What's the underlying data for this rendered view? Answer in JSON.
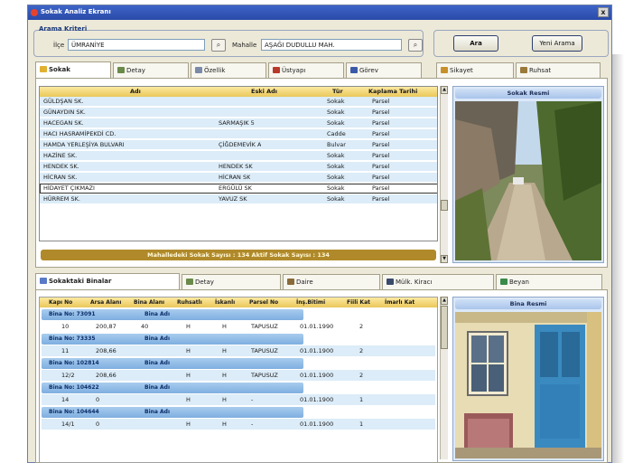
{
  "window": {
    "title": "Sokak Analiz Ekranı",
    "close_label": "x"
  },
  "search": {
    "legend": "Arama Kriteri",
    "ilce_label": "İlçe",
    "ilce_value": "ÜMRANİYE",
    "mahalle_label": "Mahalle",
    "mahalle_value": "AŞAĞI DUDULLU MAH.",
    "search_button": "Ara",
    "new_search_button": "Yeni Arama"
  },
  "top_tabs": [
    "Sokak",
    "Detay",
    "Özellik",
    "Üstyapı",
    "Görev",
    "Sikayet",
    "Ruhsat"
  ],
  "street_grid": {
    "columns": [
      "Adı",
      "Eski Adı",
      "Tür",
      "Kaplama Tarihi"
    ],
    "rows": [
      {
        "adi": "GÜLDŞAN SK.",
        "eski": "",
        "tur": "Sokak",
        "tarih": "Parsel"
      },
      {
        "adi": "GÜNAYDIN SK.",
        "eski": "",
        "tur": "Sokak",
        "tarih": "Parsel"
      },
      {
        "adi": "HACEGAN SK.",
        "eski": "SARMAŞIK 5",
        "tur": "Sokak",
        "tarih": "Parsel"
      },
      {
        "adi": "HACI HASRAMİPEKDİ CD.",
        "eski": "",
        "tur": "Cadde",
        "tarih": "Parsel"
      },
      {
        "adi": "HAMDA YERLEŞİYA BULVARI",
        "eski": "ÇİĞDEMEVİK A",
        "tur": "Bulvar",
        "tarih": "Parsel"
      },
      {
        "adi": "HAZİNE SK.",
        "eski": "",
        "tur": "Sokak",
        "tarih": "Parsel"
      },
      {
        "adi": "HENDEK SK.",
        "eski": "HENDEK SK",
        "tur": "Sokak",
        "tarih": "Parsel"
      },
      {
        "adi": "HİCRAN SK.",
        "eski": "HİCRAN SK",
        "tur": "Sokak",
        "tarih": "Parsel"
      },
      {
        "adi": "HİDAYET ÇIKMAZI",
        "eski": "ERGÜLÜ SK",
        "tur": "Sokak",
        "tarih": "Parsel"
      },
      {
        "adi": "HÜRREM SK.",
        "eski": "YAVUZ SK",
        "tur": "Sokak",
        "tarih": "Parsel"
      }
    ],
    "status": "Mahalledeki Sokak Sayısı : 134   Aktif Sokak Sayısı : 134",
    "image_title": "Sokak Resmi"
  },
  "bottom_tabs": [
    "Sokaktaki Binalar",
    "Detay",
    "Daire",
    "Mülk. Kiracı",
    "Beyan"
  ],
  "building_grid": {
    "columns": [
      "Kapı No",
      "Arsa Alanı",
      "Bina Alanı",
      "Ruhsatlı",
      "İskanlı",
      "Parsel No",
      "İnş.Bitimi",
      "Fiili Kat",
      "İmarlı Kat"
    ],
    "groups": [
      {
        "bina_no_label": "Bina No: 73091",
        "bina_adi_label": "Bina Adı",
        "row": [
          "10",
          "200,87",
          "40",
          "H",
          "H",
          "TAPUSUZ",
          "01.01.1990",
          "2",
          ""
        ]
      },
      {
        "bina_no_label": "Bina No: 73335",
        "bina_adi_label": "Bina Adı",
        "row": [
          "11",
          "208,66",
          "",
          "H",
          "H",
          "TAPUSUZ",
          "01.01.1900",
          "2",
          ""
        ]
      },
      {
        "bina_no_label": "Bina No: 102814",
        "bina_adi_label": "Bina Adı",
        "row": [
          "12/2",
          "208,66",
          "",
          "H",
          "H",
          "TAPUSUZ",
          "01.01.1900",
          "2",
          ""
        ]
      },
      {
        "bina_no_label": "Bina No: 104622",
        "bina_adi_label": "Bina Adı",
        "row": [
          "14",
          "0",
          "",
          "H",
          "H",
          "-",
          "01.01.1900",
          "1",
          ""
        ]
      },
      {
        "bina_no_label": "Bina No: 104644",
        "bina_adi_label": "Bina Adı",
        "row": [
          "14/1",
          "0",
          "",
          "H",
          "H",
          "-",
          "01.01.1900",
          "1",
          ""
        ]
      }
    ],
    "image_title": "Bina Resmi"
  }
}
